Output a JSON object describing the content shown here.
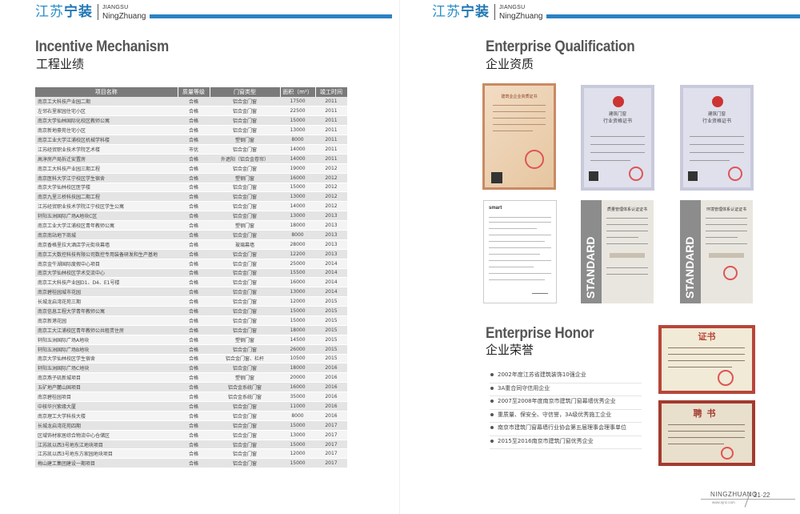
{
  "left": {
    "brand_cn_a": "江苏",
    "brand_cn_b": "宁装",
    "brand_en_1": "JIANGSU",
    "brand_en_2": "NingZhuang",
    "section_en": "Incentive Mechanism",
    "section_cn": "工程业绩"
  },
  "right": {
    "brand_cn_a": "江苏",
    "brand_cn_b": "宁装",
    "brand_en_1": "JIANGSU",
    "brand_en_2": "NingZhuang",
    "qual_en": "Enterprise Qualification",
    "qual_cn": "企业资质",
    "honor_en": "Enterprise Honor",
    "honor_cn": "企业荣誉",
    "std_label": "STANDARD",
    "cert_red_title": "建筑业企业资质证书",
    "cert_blue_title_1": "建筑门窗",
    "cert_blue_title_2": "行业资格证书",
    "cert_std_1": "质量管理体系认证证书",
    "cert_std_2": "环境管理体系认证证书",
    "cert_smart": "smart",
    "honor_cert_1": "证书",
    "honor_cert_2": "聘书"
  },
  "table": {
    "headers": [
      "项目名称",
      "质量等级",
      "门窗类型",
      "面积（m²）",
      "竣工时间"
    ],
    "rows": [
      [
        "南京工大科技产业园二期",
        "合格",
        "铝合金门窗",
        "17500",
        "2011"
      ],
      [
        "左邻右里家园住宅小区",
        "合格",
        "铝合金门窗",
        "22500",
        "2011"
      ],
      [
        "南京大学仙林国际化校区教师公寓",
        "合格",
        "铝合金门窗",
        "15000",
        "2011"
      ],
      [
        "南京新地豪苑住宅小区",
        "合格",
        "铝合金门窗",
        "13000",
        "2011"
      ],
      [
        "南京工业大学江浦校区机械学科楼",
        "合格",
        "塑钢门窗",
        "8000",
        "2011"
      ],
      [
        "江苏经贸职业技术学院艺术楼",
        "市优",
        "铝合金门窗",
        "14000",
        "2011"
      ],
      [
        "高淳房产局拆迁安置房",
        "合格",
        "外遮阳（铝合金卷帘）",
        "14000",
        "2011"
      ],
      [
        "南京工大科技产业园三期工程",
        "合格",
        "铝合金门窗",
        "19000",
        "2012"
      ],
      [
        "南京医科大学江宁校区学生宿舍",
        "合格",
        "塑钢门窗",
        "16000",
        "2012"
      ],
      [
        "南京大学仙林校区医学楼",
        "合格",
        "铝合金门窗",
        "15000",
        "2012"
      ],
      [
        "南京九里三桥科技园二期工程",
        "合格",
        "铝合金门窗",
        "13000",
        "2012"
      ],
      [
        "江苏经贸职业技术学院江宁校区学生公寓",
        "合格",
        "铝合金门窗",
        "14000",
        "2012"
      ],
      [
        "轩阳五洲国际广场A地块C区",
        "合格",
        "铝合金门窗",
        "13000",
        "2013"
      ],
      [
        "南京工业大学江浦校区青年教师公寓",
        "合格",
        "塑钢门窗",
        "18000",
        "2013"
      ],
      [
        "南京南站地下商城",
        "合格",
        "铝合金门窗",
        "8000",
        "2013"
      ],
      [
        "南京香格里拉大酒店学元街块幕墙",
        "合格",
        "玻璃幕墙",
        "28000",
        "2013"
      ],
      [
        "南京工大数控科技有限公司数控专用装备研发和生产基地",
        "合格",
        "铝合金门窗",
        "12200",
        "2013"
      ],
      [
        "南京金牛湖国际度假中心项目",
        "合格",
        "铝合金门窗",
        "25000",
        "2014"
      ],
      [
        "南京大学仙林校区学术交流中心",
        "合格",
        "铝合金门窗",
        "15500",
        "2014"
      ],
      [
        "南京工大科技产业园D1、D4、E1号楼",
        "合格",
        "铝合金门窗",
        "16000",
        "2014"
      ],
      [
        "南京碧桂园城市花园",
        "合格",
        "铝合金门窗",
        "13000",
        "2014"
      ],
      [
        "长城龙启湾花苑三期",
        "合格",
        "铝合金门窗",
        "12000",
        "2015"
      ],
      [
        "南京信息工程大学青年教师公寓",
        "合格",
        "铝合金门窗",
        "15000",
        "2015"
      ],
      [
        "南京新港花园",
        "合格",
        "铝合金门窗",
        "15000",
        "2015"
      ],
      [
        "南京工大江浦校区青年教师公共租赁住房",
        "合格",
        "铝合金门窗",
        "18000",
        "2015"
      ],
      [
        "轩阳五洲国际广场A地块",
        "合格",
        "塑钢门窗",
        "14500",
        "2015"
      ],
      [
        "轩阳五洲国际广场B地块",
        "合格",
        "铝合金门窗",
        "26000",
        "2015"
      ],
      [
        "南京大学仙林校区学生宿舍",
        "合格",
        "铝合金门窗、栏杆",
        "10500",
        "2015"
      ],
      [
        "轩阳五洲国际广场C地块",
        "合格",
        "铝合金门窗",
        "18000",
        "2016"
      ],
      [
        "南京燕子矶新城项目",
        "合格",
        "塑钢门窗",
        "20000",
        "2016"
      ],
      [
        "五矿地产麓山国项目",
        "合格",
        "铝合金系统门窗",
        "16000",
        "2016"
      ],
      [
        "南京碧桂园项目",
        "合格",
        "铝合金系统门窗",
        "35000",
        "2016"
      ],
      [
        "中核华兴紫缘大厦",
        "合格",
        "铝合金门窗",
        "11000",
        "2016"
      ],
      [
        "南京理工大学科技大楼",
        "合格",
        "铝合金门窗",
        "8000",
        "2016"
      ],
      [
        "长城龙启湾花苑四期",
        "合格",
        "铝合金门窗",
        "15000",
        "2017"
      ],
      [
        "区域饰材家居综合物流中心仓储区",
        "合格",
        "铝合金门窗",
        "13000",
        "2017"
      ],
      [
        "江苏凯以西3号地东江地块项目",
        "合格",
        "铝合金门窗",
        "15000",
        "2017"
      ],
      [
        "江苏凯以西3号地东方家园地块项目",
        "合格",
        "铝合金门窗",
        "12000",
        "2017"
      ],
      [
        "梅山建工集团建设一期项目",
        "合格",
        "铝合金门窗",
        "15000",
        "2017"
      ]
    ]
  },
  "honors": [
    "2002年度江苏省建筑装饰10强企业",
    "3A重合同守信用企业",
    "2007至2008年度南京市建筑门窗幕墙优秀企业",
    "重质量、保安全、守信誉，3A级优秀施工企业",
    "南京市建筑门窗幕墙行业协会第五届理事会理事单位",
    "2015至2016南京市建筑门窗优秀企业"
  ],
  "footer": {
    "brand": "NINGZHUANG",
    "url": "www.njnz.com",
    "pages": "21·22"
  },
  "colors": {
    "brand_blue": "#2a82c2",
    "table_header": "#7a7a7a"
  }
}
